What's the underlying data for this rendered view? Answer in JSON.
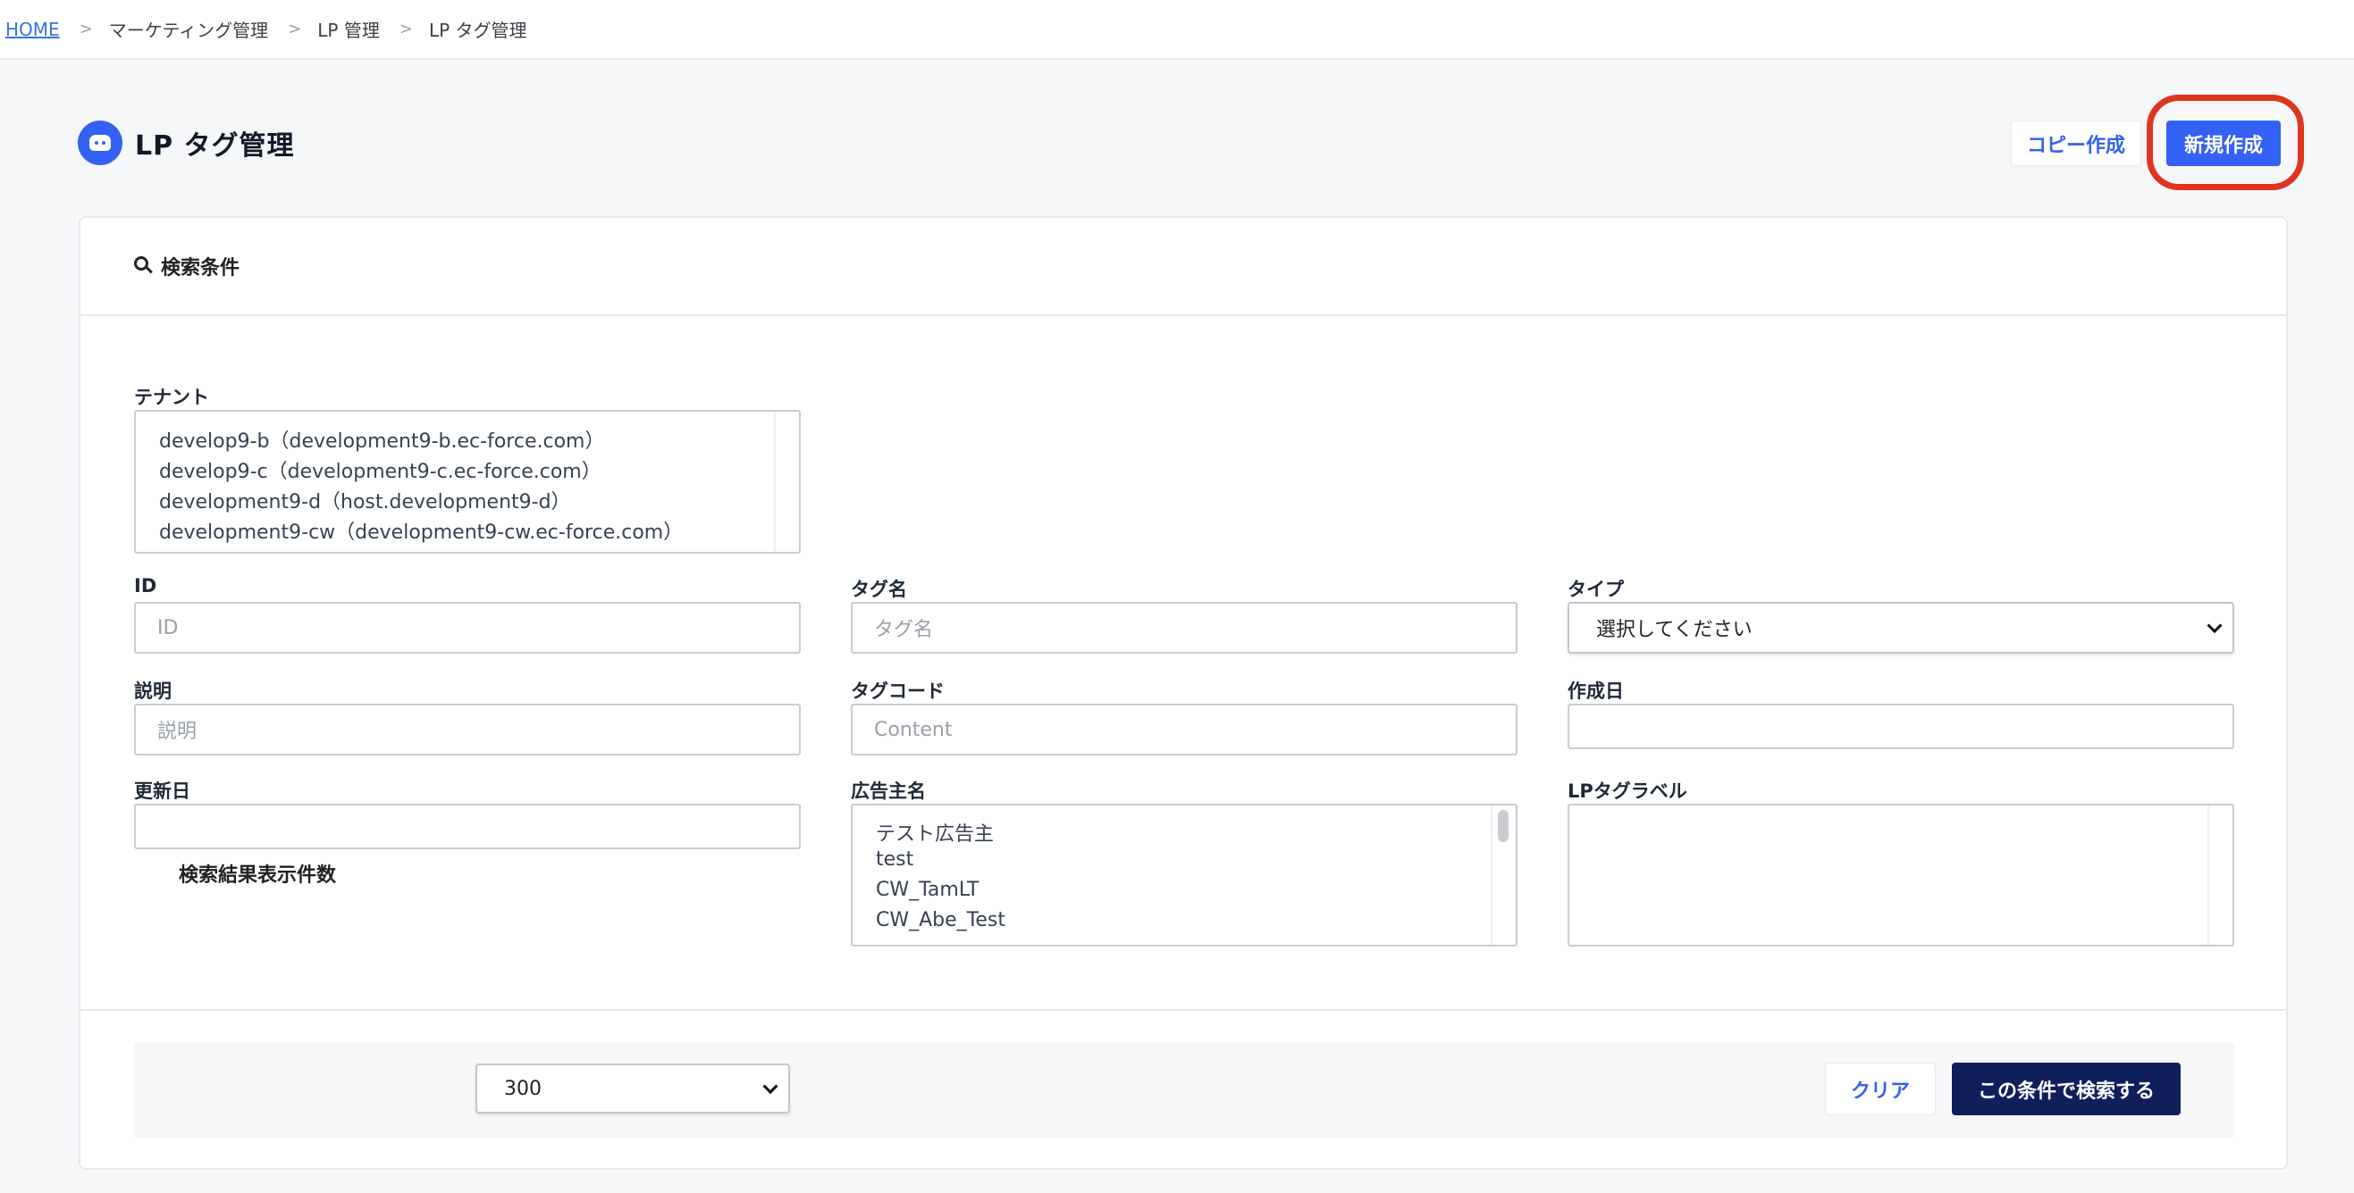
{
  "breadcrumb": {
    "home": "HOME",
    "sep": ">",
    "items": [
      "マーケティング管理",
      "LP 管理",
      "LP タグ管理"
    ]
  },
  "page": {
    "title": "LP タグ管理",
    "copy_button": "コピー作成",
    "new_button": "新規作成"
  },
  "search": {
    "header": "検索条件",
    "tenant": {
      "label": "テナント",
      "options": [
        "develop9-b（development9-b.ec-force.com）",
        "develop9-c（development9-c.ec-force.com）",
        "development9-d（host.development9-d）",
        "development9-cw（development9-cw.ec-force.com）"
      ]
    },
    "id": {
      "label": "ID",
      "placeholder": "ID"
    },
    "tag_name": {
      "label": "タグ名",
      "placeholder": "タグ名"
    },
    "type": {
      "label": "タイプ",
      "selected": "選択してください"
    },
    "description": {
      "label": "説明",
      "placeholder": "説明"
    },
    "tag_code": {
      "label": "タグコード",
      "placeholder": "Content"
    },
    "created": {
      "label": "作成日"
    },
    "updated": {
      "label": "更新日"
    },
    "advertiser": {
      "label": "広告主名",
      "options": [
        "テスト広告主",
        "test",
        "CW_TamLT",
        "CW_Abe_Test"
      ]
    },
    "lp_tag_label": {
      "label": "LPタグラベル"
    }
  },
  "footer": {
    "results_label": "検索結果表示件数",
    "results_count": "300",
    "clear_button": "クリア",
    "submit_button": "この条件で検索する"
  },
  "colors": {
    "accent": "#3461f5",
    "primary_dark": "#0f1f5c",
    "highlight": "#e0341e"
  }
}
